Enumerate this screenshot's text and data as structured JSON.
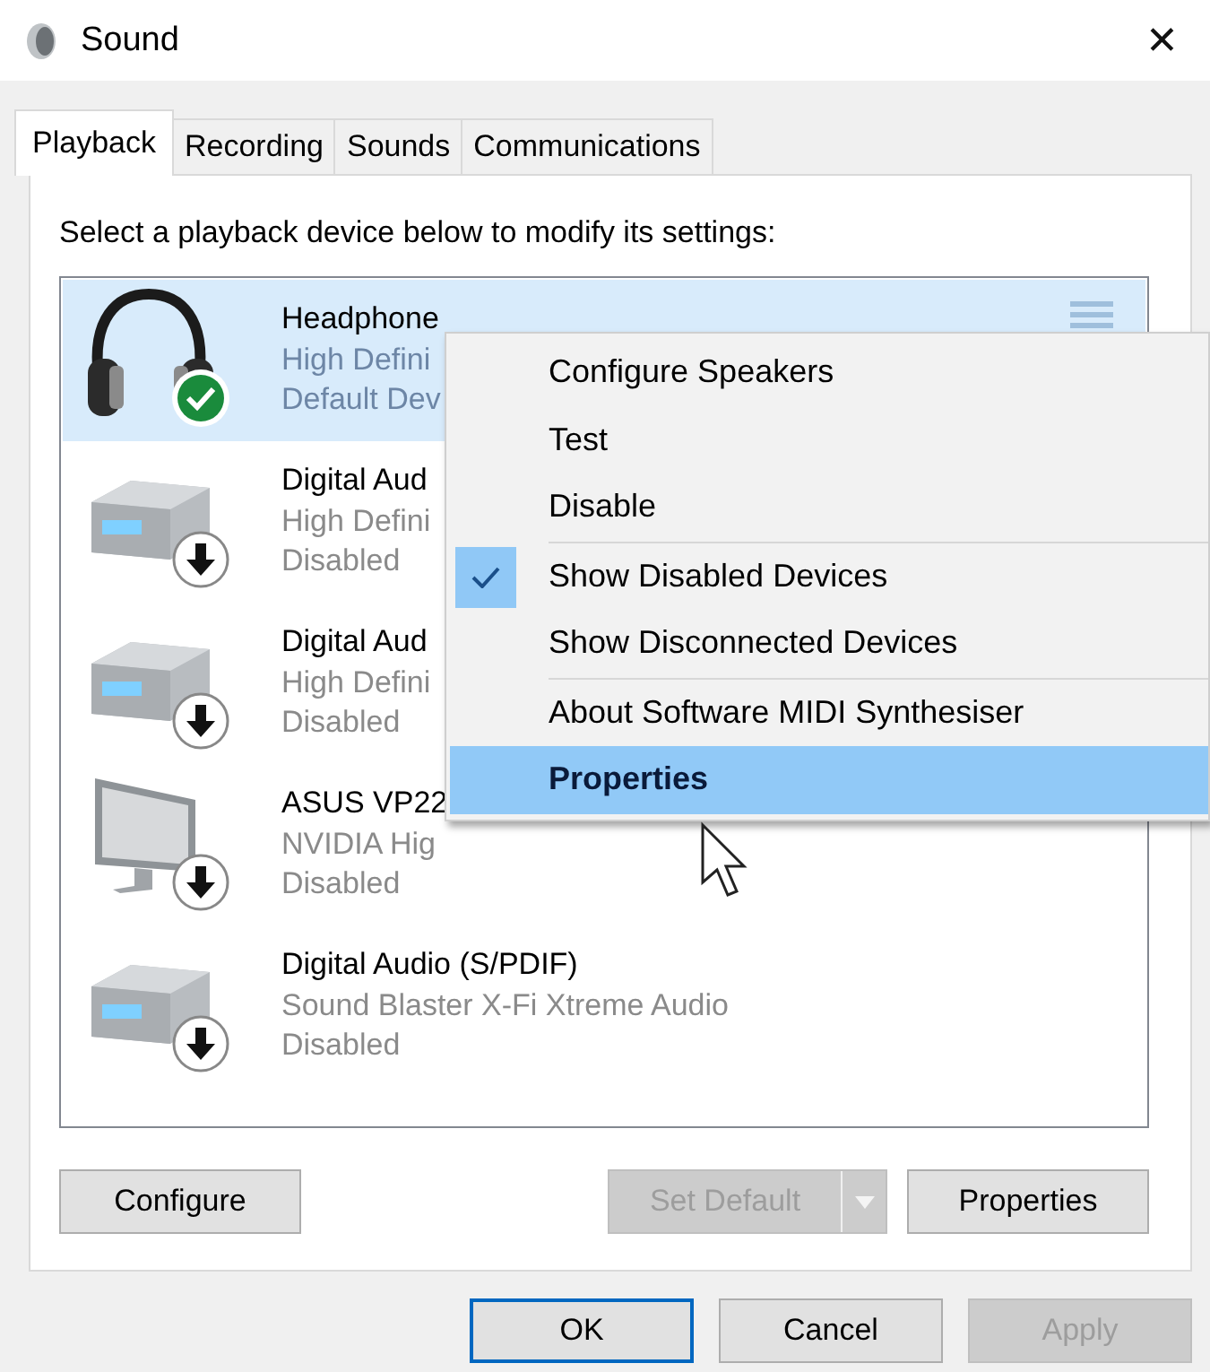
{
  "window": {
    "title": "Sound",
    "close": "✕"
  },
  "tabs": [
    {
      "label": "Playback",
      "selected": true
    },
    {
      "label": "Recording",
      "selected": false
    },
    {
      "label": "Sounds",
      "selected": false
    },
    {
      "label": "Communications",
      "selected": false
    }
  ],
  "instruction": "Select a playback device below to modify its settings:",
  "devices": [
    {
      "kind": "headphones",
      "name": "Headphone",
      "description": "High Defini",
      "status": "Default Dev",
      "selected": true,
      "default": true
    },
    {
      "kind": "receiver",
      "name": "Digital Aud",
      "description": "High Defini",
      "status": "Disabled",
      "selected": false,
      "default": false
    },
    {
      "kind": "receiver",
      "name": "Digital Aud",
      "description": "High Defini",
      "status": "Disabled",
      "selected": false,
      "default": false
    },
    {
      "kind": "monitor",
      "name": "ASUS VP22",
      "description": "NVIDIA Hig",
      "status": "Disabled",
      "selected": false,
      "default": false
    },
    {
      "kind": "receiver",
      "name": "Digital Audio (S/PDIF)",
      "description": "Sound Blaster X-Fi Xtreme Audio",
      "status": "Disabled",
      "selected": false,
      "default": false
    }
  ],
  "panel_buttons": [
    {
      "label": "Configure",
      "disabled": false,
      "split": false
    },
    {
      "label": "Set Default",
      "disabled": true,
      "split": true
    },
    {
      "label": "Properties",
      "disabled": false,
      "split": false
    }
  ],
  "dialog_buttons": [
    {
      "label": "OK",
      "disabled": false,
      "focused": true
    },
    {
      "label": "Cancel",
      "disabled": false,
      "focused": false
    },
    {
      "label": "Apply",
      "disabled": true,
      "focused": false
    }
  ],
  "context_menu": [
    {
      "kind": "item",
      "label": "Configure Speakers",
      "checked": false,
      "highlighted": false,
      "bold": false
    },
    {
      "kind": "item",
      "label": "Test",
      "checked": false,
      "highlighted": false,
      "bold": false
    },
    {
      "kind": "item",
      "label": "Disable",
      "checked": false,
      "highlighted": false,
      "bold": false
    },
    {
      "kind": "separator"
    },
    {
      "kind": "item",
      "label": "Show Disabled Devices",
      "checked": true,
      "highlighted": false,
      "bold": false
    },
    {
      "kind": "item",
      "label": "Show Disconnected Devices",
      "checked": false,
      "highlighted": false,
      "bold": false
    },
    {
      "kind": "separator"
    },
    {
      "kind": "item",
      "label": "About Software MIDI Synthesiser",
      "checked": false,
      "highlighted": false,
      "bold": false
    },
    {
      "kind": "item",
      "label": "Properties",
      "checked": false,
      "highlighted": true,
      "bold": true
    }
  ]
}
